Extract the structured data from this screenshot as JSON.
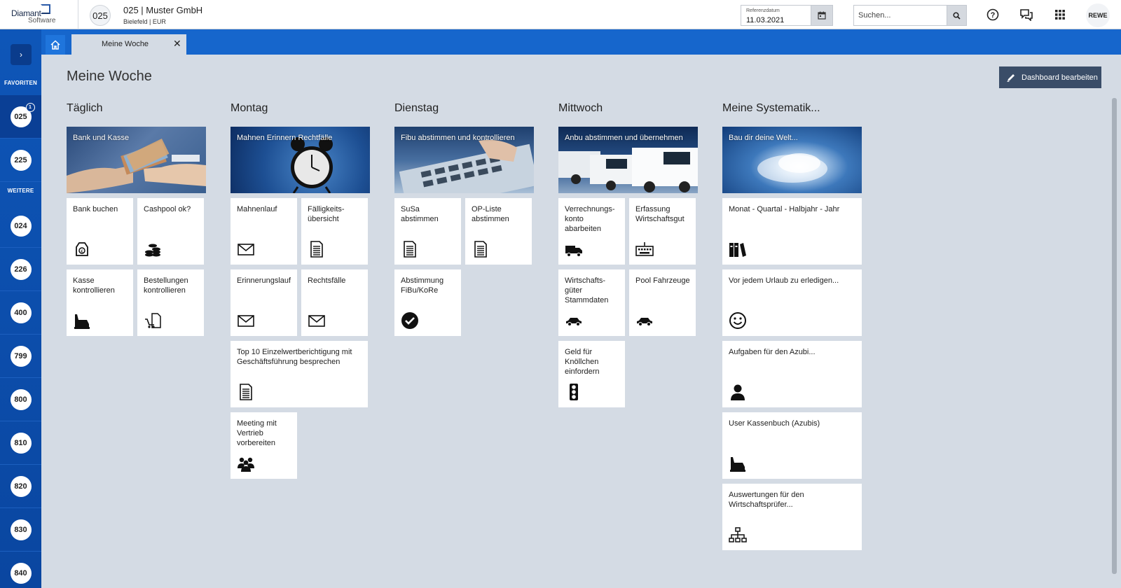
{
  "header": {
    "logo_text": "Diamant",
    "logo_sub": "Software",
    "company_code": "025",
    "company_name": "025 | Muster GmbH",
    "company_sub": "Bielefeld | EUR",
    "refdate_label": "Referenzdatum",
    "refdate_value": "11.03.2021",
    "search_placeholder": "Suchen...",
    "user": "REWE"
  },
  "sidebar": {
    "toggle": "›",
    "section_favorites": "FAVORITEN",
    "section_more": "WEITERE",
    "favorites": [
      {
        "code": "025",
        "badge": "1"
      },
      {
        "code": "225"
      }
    ],
    "more": [
      "024",
      "226",
      "400",
      "799",
      "800",
      "810",
      "820",
      "830",
      "840"
    ]
  },
  "tabs": {
    "active": "Meine Woche",
    "close": "✕"
  },
  "page": {
    "title": "Meine Woche",
    "edit_button": "Dashboard bearbeiten"
  },
  "columns": [
    {
      "title": "Täglich",
      "banner": "Bank und Kasse",
      "tiles": [
        "Bank buchen",
        "Cashpool ok?",
        "Kasse kontrollieren",
        "Bestellungen kontrollieren"
      ]
    },
    {
      "title": "Montag",
      "banner": "Mahnen Erinnern Rechtfälle",
      "tiles": [
        "Mahnenlauf",
        "Fälligkeits-übersicht",
        "Erinnerungslauf",
        "Rechtsfälle",
        "Top 10 Einzelwertberichtigung mit Geschäftsführung besprechen",
        "Meeting mit Vertrieb vorbereiten"
      ]
    },
    {
      "title": "Dienstag",
      "banner": "Fibu abstimmen und kontrollieren",
      "tiles": [
        "SuSa abstimmen",
        "OP-Liste abstimmen",
        "Abstimmung FiBu/KoRe"
      ]
    },
    {
      "title": "Mittwoch",
      "banner": "Anbu abstimmen und übernehmen",
      "tiles": [
        "Verrechnungs-konto abarbeiten",
        "Erfassung Wirtschaftsgut",
        "Wirtschafts-güter Stammdaten",
        "Pool Fahrzeuge",
        "Geld für Knöllchen einfordern"
      ]
    },
    {
      "title": "Meine Systematik...",
      "banner": "Bau dir deine Welt...",
      "tiles": [
        "Monat - Quartal - Halbjahr - Jahr",
        "Vor jedem Urlaub zu erledigen...",
        "Aufgaben für den Azubi...",
        "User Kassenbuch (Azubis)",
        "Auswertungen für den Wirtschaftsprüfer..."
      ]
    }
  ],
  "colors": {
    "sidebar": "#0e56b8",
    "tabbar": "#1666cc",
    "content_bg": "#d4dbe4",
    "edit_button": "#3a4d68"
  },
  "icons": {
    "bank": "money-bag-icon",
    "cashpool": "coins-icon",
    "kasse": "cash-register-icon",
    "bestellungen": "cart-document-icon",
    "mail": "envelope-icon",
    "document": "document-lines-icon",
    "check": "check-circle-icon",
    "truck": "truck-icon",
    "keyboard": "keyboard-icon",
    "car": "car-icon",
    "traffic": "traffic-light-icon",
    "group": "group-icon",
    "books": "books-icon",
    "smile": "smile-icon",
    "person": "person-icon",
    "network": "network-icon"
  }
}
